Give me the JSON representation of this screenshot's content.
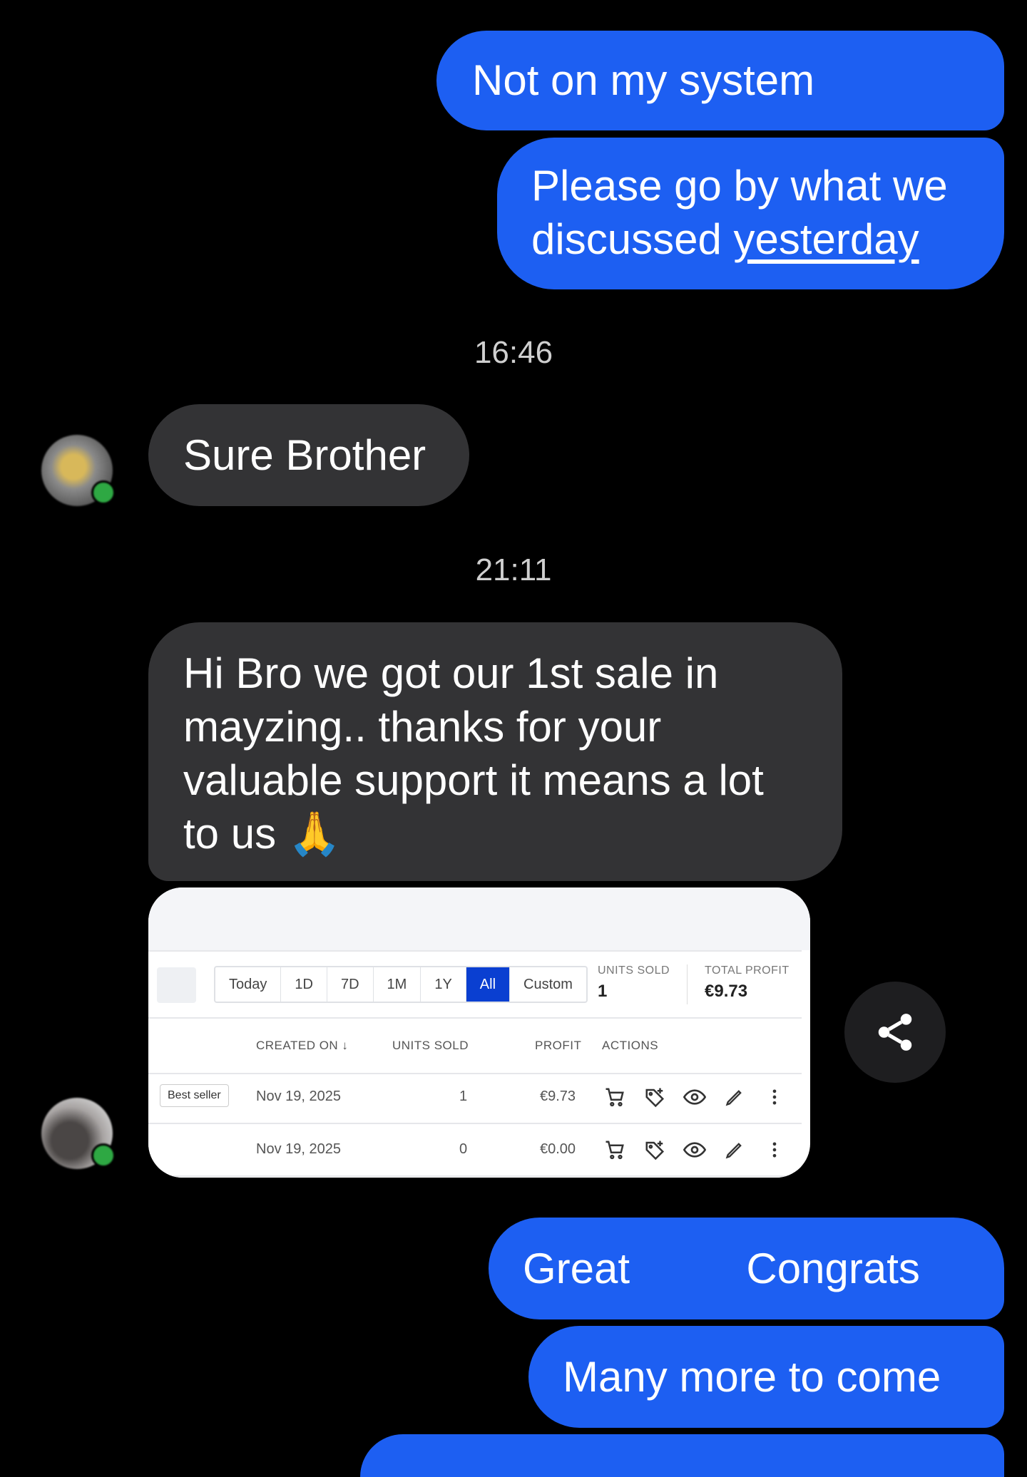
{
  "messages": {
    "m1": "Not on my system",
    "m2_line1": "Please go by what we",
    "m2_line2_pre": "discussed ",
    "m2_link": "yesterday",
    "ts1": "16:46",
    "m3": "Sure Brother",
    "ts2": "21:11",
    "m4_line1": "Hi Bro we got our 1st sale in",
    "m4_line2": "mayzing.. thanks for your",
    "m4_line3": "valuable support it means a lot",
    "m4_line4": "to us 🙏",
    "m5_a": "Great",
    "m5_b": "Congrats",
    "m6": "Many more to come"
  },
  "card": {
    "ranges": [
      "Today",
      "1D",
      "7D",
      "1M",
      "1Y",
      "All",
      "Custom"
    ],
    "active_range": "All",
    "units_sold_label": "UNITS SOLD",
    "units_sold_value": "1",
    "total_profit_label": "TOTAL PROFIT",
    "total_profit_value": "€9.73",
    "columns": {
      "created_on": "CREATED ON ↓",
      "units_sold": "UNITS SOLD",
      "profit": "PROFIT",
      "actions": "ACTIONS"
    },
    "rows": [
      {
        "badge": "Best seller",
        "created": "Nov 19, 2025",
        "units": "1",
        "profit": "€9.73"
      },
      {
        "badge": "",
        "created": "Nov 19, 2025",
        "units": "0",
        "profit": "€0.00"
      }
    ],
    "action_icons": [
      "cart-icon",
      "tag-plus-icon",
      "eye-icon",
      "pencil-icon",
      "more-vertical-icon"
    ]
  },
  "colors": {
    "outgoing": "#1d5ff2",
    "incoming": "#333335",
    "active_range": "#0a3fd1"
  }
}
